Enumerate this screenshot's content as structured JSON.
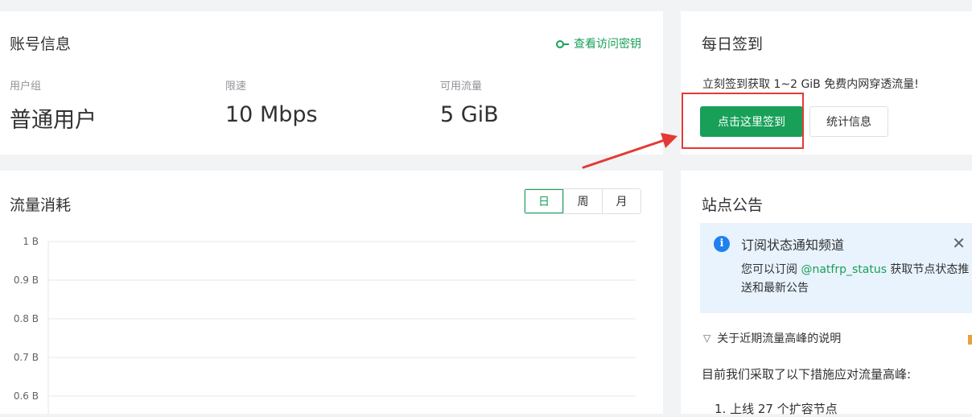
{
  "account": {
    "title": "账号信息",
    "key_link": "查看访问密钥",
    "stats": [
      {
        "label": "用户组",
        "value": "普通用户"
      },
      {
        "label": "限速",
        "value": "10 Mbps"
      },
      {
        "label": "可用流量",
        "value": "5 GiB"
      }
    ]
  },
  "checkin": {
    "title": "每日签到",
    "desc": "立刻签到获取 1~2 GiB 免费内网穿透流量!",
    "button": "点击这里签到",
    "stats_button": "统计信息"
  },
  "traffic": {
    "title": "流量消耗",
    "tabs": [
      "日",
      "周",
      "月"
    ],
    "active_tab": "日"
  },
  "chart_data": {
    "type": "line",
    "title": "",
    "y_tick_labels": [
      "1 B",
      "0.9 B",
      "0.8 B",
      "0.7 B",
      "0.6 B"
    ],
    "y_ticks": [
      1,
      0.9,
      0.8,
      0.7,
      0.6
    ],
    "ylim": [
      0.6,
      1
    ],
    "series": [],
    "grid": true
  },
  "notice": {
    "title": "站点公告",
    "alert_title": "订阅状态通知频道",
    "alert_body_prefix": "您可以订阅 ",
    "alert_handle": "@natfrp_status",
    "alert_body_suffix": " 获取节点状态推送和最新公告",
    "collapse_title": "关于近期流量高峰的说明",
    "text": "目前我们采取了以下措施应对流量高峰:",
    "list_item_1": "1. 上线 27 个扩容节点"
  },
  "colors": {
    "primary": "#18a058",
    "info": "#2080f0",
    "annotation": "#e53935"
  }
}
